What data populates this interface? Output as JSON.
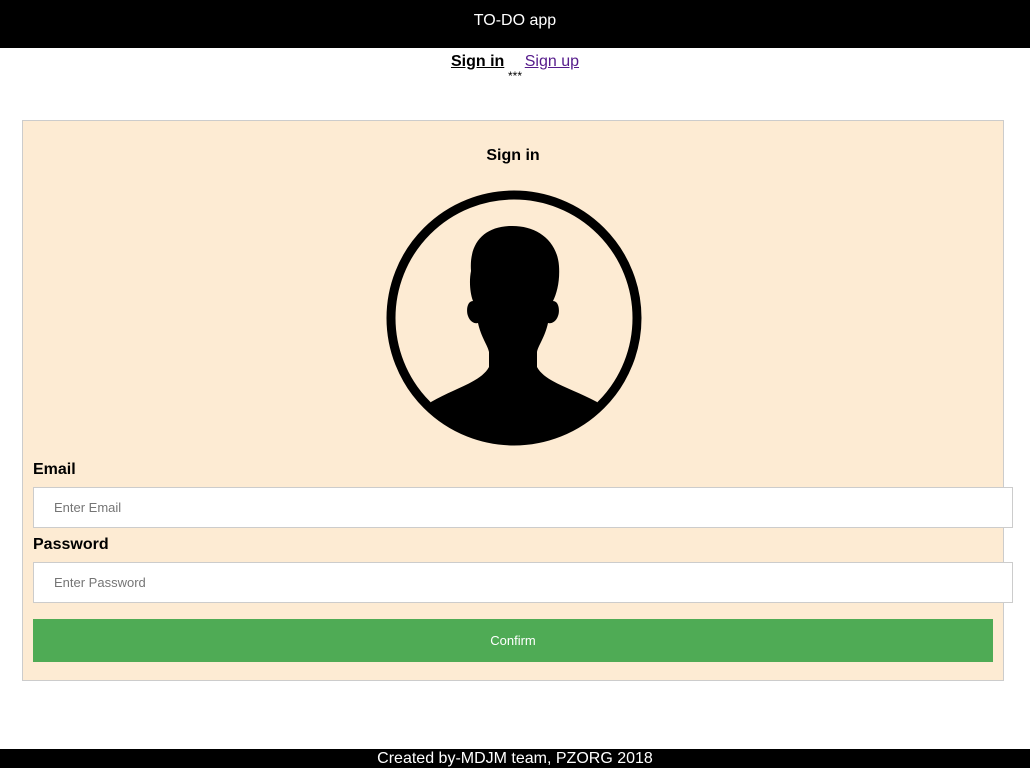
{
  "header": {
    "title": "TO-DO app"
  },
  "nav": {
    "sign_in": "Sign in",
    "sign_up": "Sign up",
    "separator": "***"
  },
  "form": {
    "title": "Sign in",
    "avatar_icon": "user-silhouette-icon",
    "email_label": "Email",
    "email_placeholder": "Enter Email",
    "email_value": "",
    "password_label": "Password",
    "password_placeholder": "Enter Password",
    "password_value": "",
    "confirm_label": "Confirm"
  },
  "footer": {
    "text": "Created by-MDJM team, PZORG 2018"
  },
  "colors": {
    "header_bg": "#000000",
    "card_bg": "#fdebd3",
    "confirm_bg": "#4fab55",
    "footer_bg": "#000000"
  }
}
